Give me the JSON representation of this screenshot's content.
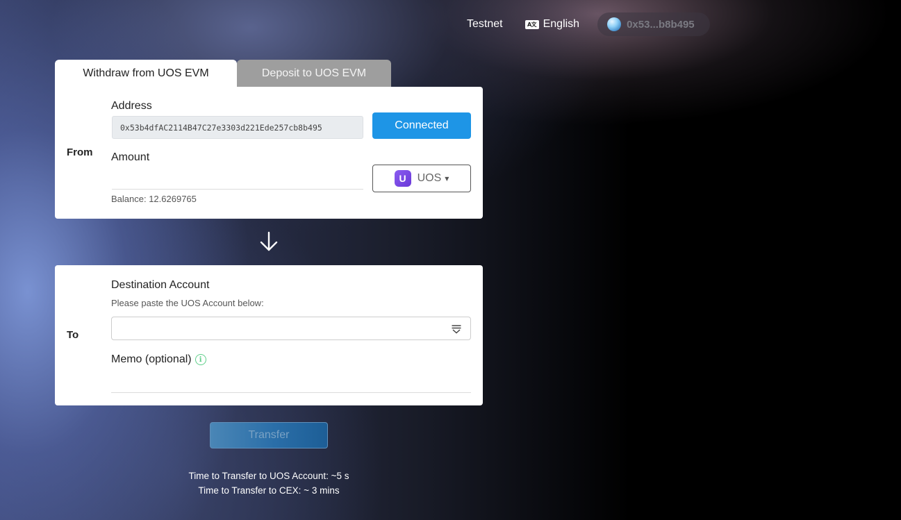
{
  "header": {
    "network": "Testnet",
    "language_icon": "language-icon",
    "language": "English",
    "wallet_address_short": "0x53...b8b495"
  },
  "tabs": [
    {
      "label": "Withdraw from UOS EVM",
      "active": true
    },
    {
      "label": "Deposit to UOS EVM",
      "active": false
    }
  ],
  "from_section": {
    "side_label": "From",
    "address_label": "Address",
    "address_value": "0x53b4dfAC2114B47C27e3303d221Ede257cb8b495",
    "connect_button": "Connected",
    "amount_label": "Amount",
    "amount_value": "",
    "balance_text": "Balance: 12.6269765",
    "token": {
      "logo_letter": "U",
      "name": "UOS",
      "icon": "uos-logo"
    }
  },
  "to_section": {
    "side_label": "To",
    "destination_label": "Destination Account",
    "destination_hint": "Please paste the UOS Account below:",
    "destination_value": "",
    "memo_label": "Memo (optional)",
    "memo_info_icon": "info-icon",
    "memo_value": ""
  },
  "transfer_button": "Transfer",
  "notes": {
    "uos_account_time": "Time to Transfer to UOS Account: ~5 s",
    "cex_time": "Time to Transfer to CEX: ~ 3 mins"
  },
  "colors": {
    "primary": "#1e95e6",
    "transfer_button": "#2a6ea8",
    "inactive_tab": "#9e9e9e",
    "info_green": "#5fcf8a",
    "uos_purple": "#7a4ae4"
  }
}
